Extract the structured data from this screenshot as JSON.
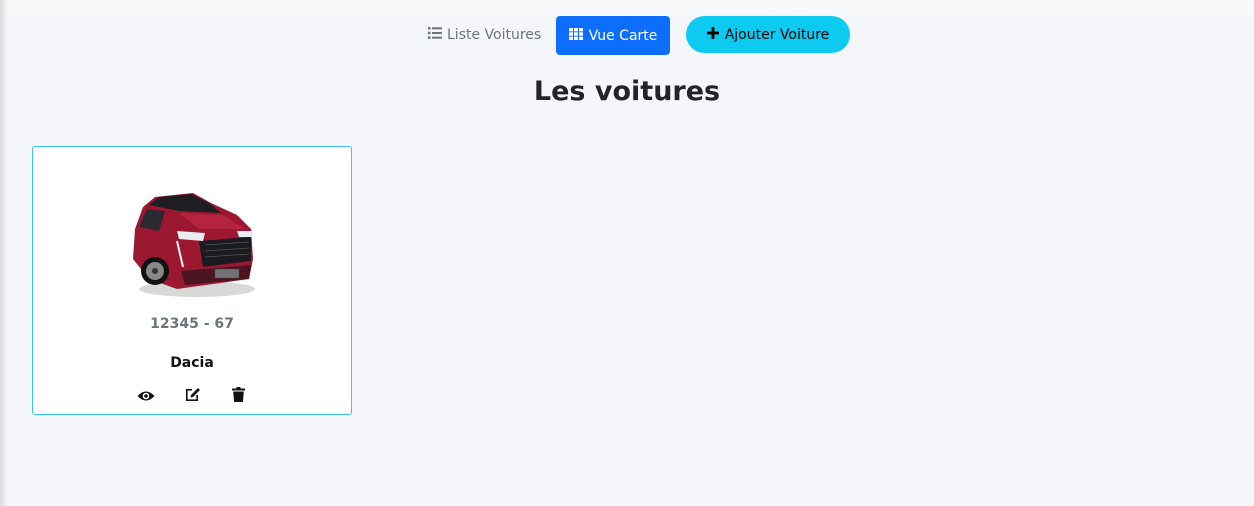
{
  "toolbar": {
    "list_view_label": "Liste Voitures",
    "card_view_label": "Vue Carte",
    "add_car_label": "Ajouter Voiture"
  },
  "page": {
    "title": "Les voitures"
  },
  "cars": [
    {
      "plate": "12345 - 67",
      "brand": "Dacia",
      "image_icon": "car-photo-red-hatchback",
      "actions": [
        "eye-icon",
        "edit-icon",
        "trash-icon"
      ]
    }
  ],
  "colors": {
    "primary": "#0d6efd",
    "info": "#0dcaf0",
    "muted": "#6c757d",
    "card_border": "#39c4ee",
    "car_body": "#9b1830"
  }
}
